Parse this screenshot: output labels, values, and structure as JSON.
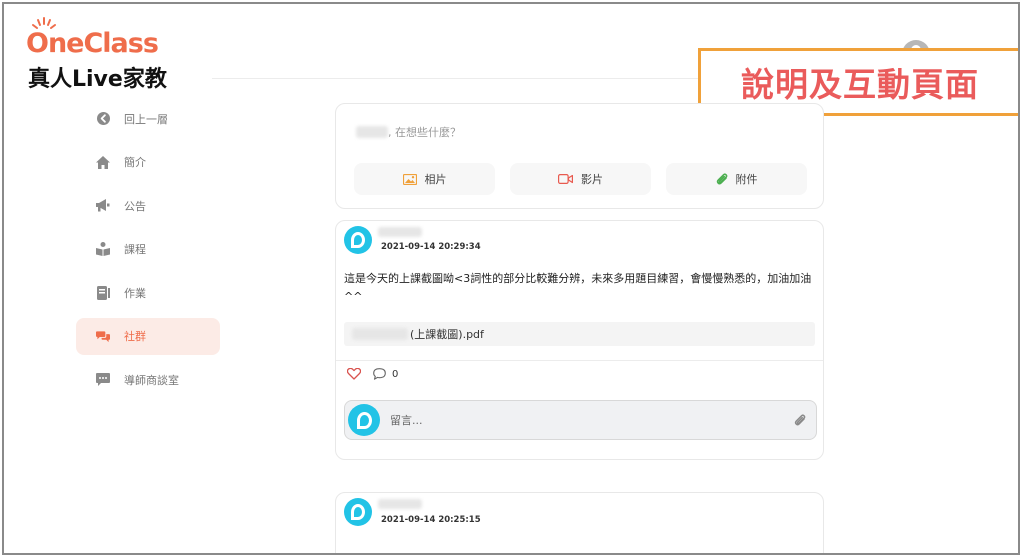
{
  "brand": {
    "logo_text": "OneClass",
    "tagline": "真人Live家教",
    "logo_color": "#ef6d4b"
  },
  "annotation": {
    "text": "說明及互動頁面",
    "border_color": "#f0a13a",
    "text_color": "#ea5b5b"
  },
  "header": {
    "user_avatar_icon": "user-avatar-icon"
  },
  "sidebar": {
    "items": [
      {
        "label": "回上一層",
        "icon": "back-arrow-icon",
        "active": false
      },
      {
        "label": "簡介",
        "icon": "home-icon",
        "active": false
      },
      {
        "label": "公告",
        "icon": "megaphone-icon",
        "active": false
      },
      {
        "label": "課程",
        "icon": "book-reader-icon",
        "active": false
      },
      {
        "label": "作業",
        "icon": "notebook-icon",
        "active": false
      },
      {
        "label": "社群",
        "icon": "chat-bubbles-icon",
        "active": true
      },
      {
        "label": "導師商談室",
        "icon": "message-icon",
        "active": false
      }
    ],
    "active_color": "#ef6d4b",
    "active_bg": "#fcebe6"
  },
  "composer": {
    "prompt_suffix": ", 在想些什麼？",
    "actions": [
      {
        "label": "相片",
        "icon": "image-icon",
        "color": "#f0a13a"
      },
      {
        "label": "影片",
        "icon": "video-icon",
        "color": "#e85a4f"
      },
      {
        "label": "附件",
        "icon": "paperclip-icon",
        "color": "#4caf50"
      }
    ]
  },
  "posts": [
    {
      "timestamp": "2021-09-14 20:29:34",
      "text": "這是今天的上課截圖呦<3詞性的部分比較難分辨，未來多用題目練習，會慢慢熟悉的，加油加油^^",
      "attachment_suffix": "(上課截圖).pdf",
      "comment_count": "0",
      "comment_placeholder": "留言..."
    },
    {
      "timestamp": "2021-09-14 20:25:15"
    }
  ]
}
